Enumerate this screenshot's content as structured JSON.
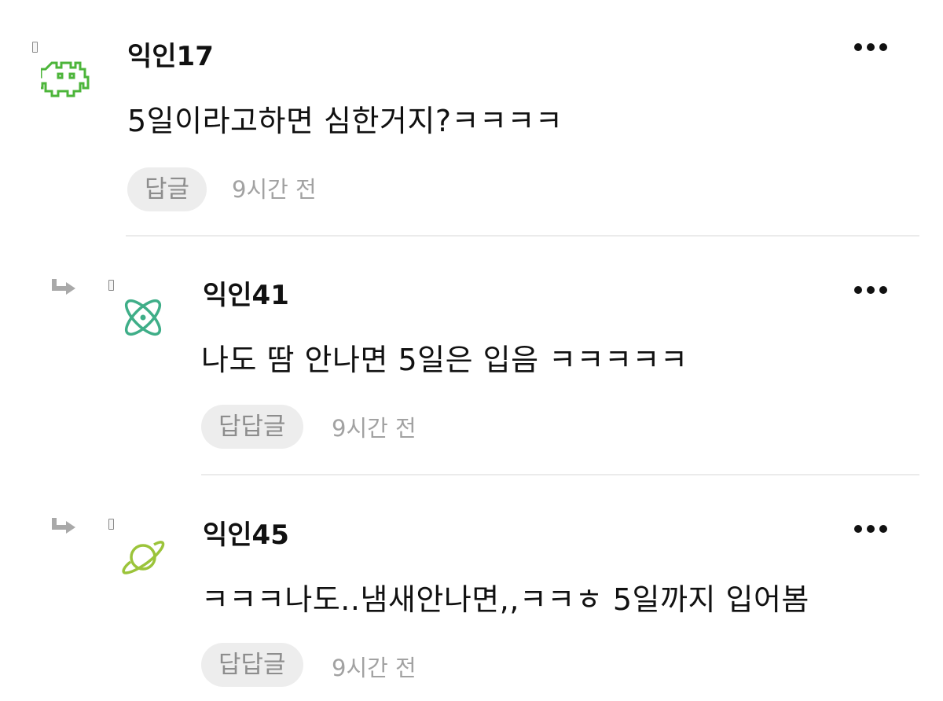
{
  "comments": [
    {
      "author": "익인17",
      "text": "5일이라고하면 심한거지?ㅋㅋㅋㅋ",
      "reply_label": "답글",
      "time": "9시간 전",
      "avatar_icon": "space-invader-icon",
      "avatar_color": "#4cb53a",
      "is_reply": false
    },
    {
      "author": "익인41",
      "text": "나도 땀 안나면 5일은 입음 ㅋㅋㅋㅋㅋ",
      "reply_label": "답답글",
      "time": "9시간 전",
      "avatar_icon": "atom-icon",
      "avatar_color": "#3fae88",
      "is_reply": true
    },
    {
      "author": "익인45",
      "text": "ㅋㅋㅋ나도..냄새안나면,,ㅋㅋㅎ 5일까지 입어봄",
      "reply_label": "답답글",
      "time": "9시간 전",
      "avatar_icon": "planet-icon",
      "avatar_color": "#9bc43a",
      "is_reply": true
    }
  ]
}
